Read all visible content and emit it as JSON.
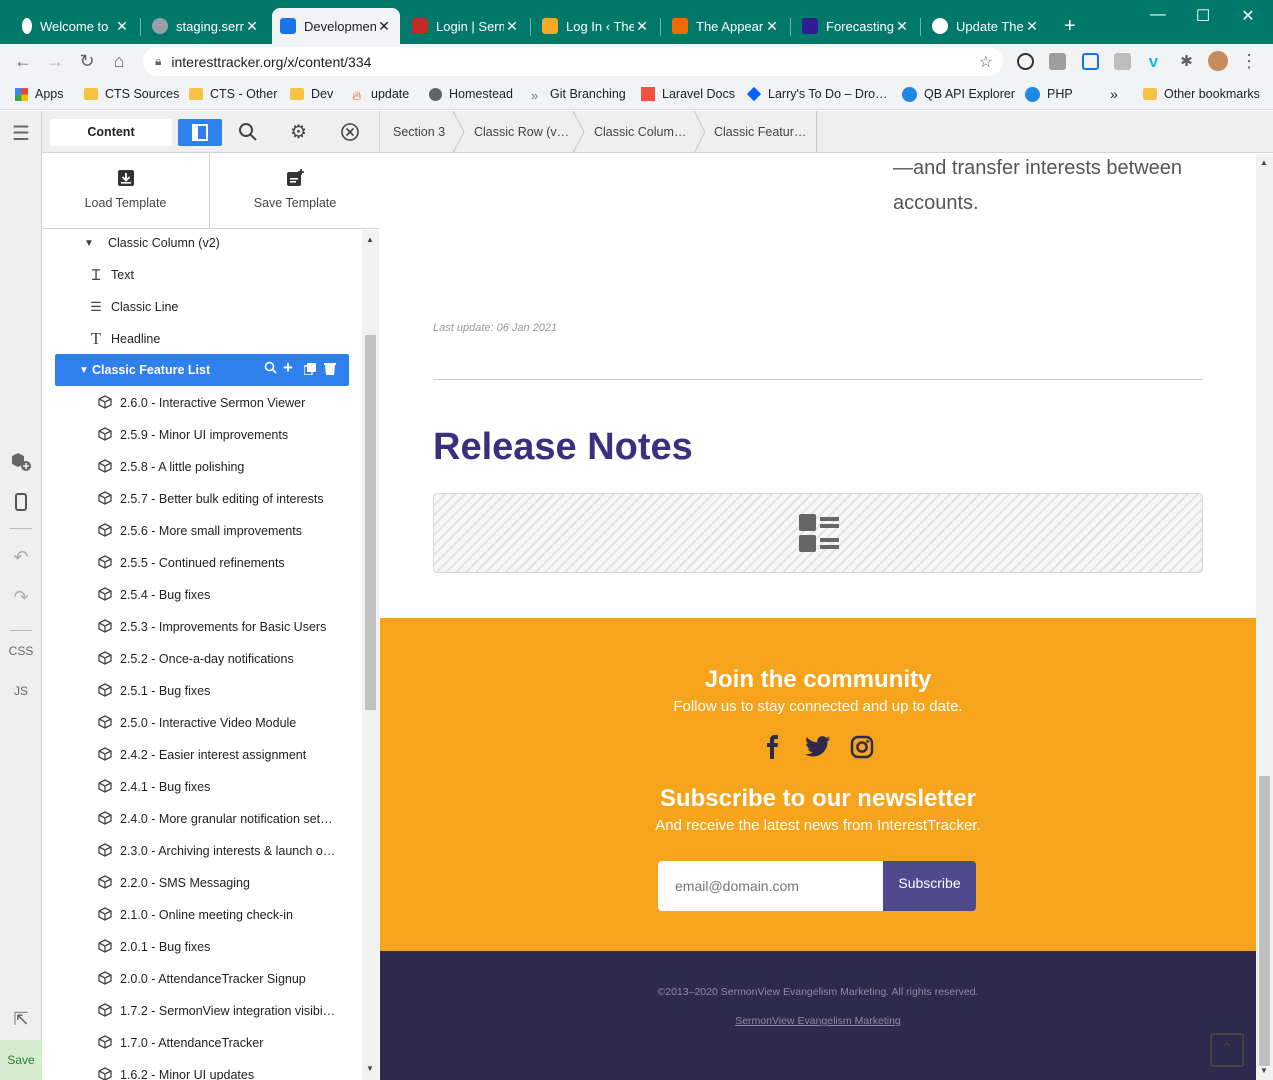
{
  "browser": {
    "tabs": [
      {
        "title": "Welcome to",
        "color": "#ffffff"
      },
      {
        "title": "staging.serm",
        "color": "#9aa0a6"
      },
      {
        "title": "Developmen",
        "color": "#1a73e8"
      },
      {
        "title": "Login | Serm",
        "color": "#c62828"
      },
      {
        "title": "Log In ‹ The",
        "color": "#f9a825"
      },
      {
        "title": "The Appeari",
        "color": "#ef6c00"
      },
      {
        "title": "Forecasting",
        "color": "#311b92"
      },
      {
        "title": "Update Ther",
        "color": "#ffffff"
      }
    ],
    "new_tab": "+",
    "url": "interesttracker.org/x/content/334",
    "bookmarks": [
      "Apps",
      "CTS Sources",
      "CTS - Other",
      "Dev",
      "update",
      "Homestead",
      "Git Branching",
      "Laravel Docs",
      "Larry's To Do – Dro…",
      "QB API Explorer",
      "PHP"
    ],
    "bookmarks_overflow": "»",
    "other_bookmarks": "Other bookmarks"
  },
  "rail": {
    "css": "CSS",
    "js": "JS",
    "save": "Save"
  },
  "panel": {
    "content_tab": "Content",
    "load_template": "Load Template",
    "save_template": "Save Template"
  },
  "tree": {
    "parent": "Classic Column (v2)",
    "children": [
      {
        "label": "Text",
        "icon": "text-cursor-icon"
      },
      {
        "label": "Classic Line",
        "icon": "line-icon"
      },
      {
        "label": "Headline",
        "icon": "headline-icon"
      }
    ],
    "selected": "Classic Feature List",
    "features": [
      "2.6.0 - Interactive Sermon Viewer",
      "2.5.9 - Minor UI improvements",
      "2.5.8 - A little polishing",
      "2.5.7 - Better bulk editing of interests",
      "2.5.6 - More small improvements",
      "2.5.5 - Continued refinements",
      "2.5.4 - Bug fixes",
      "2.5.3 - Improvements for Basic Users",
      "2.5.2 - Once-a-day notifications",
      "2.5.1 - Bug fixes",
      "2.5.0 - Interactive Video Module",
      "2.4.2 - Easier interest assignment",
      "2.4.1 - Bug fixes",
      "2.4.0 - More granular notification set…",
      "2.3.0 - Archiving interests & launch o…",
      "2.2.0 - SMS Messaging",
      "2.1.0 - Online meeting check-in",
      "2.0.1 - Bug fixes",
      "2.0.0 - AttendanceTracker Signup",
      "1.7.2 - SermonView integration visibi…",
      "1.7.0 - AttendanceTracker",
      "1.6.2 - Minor UI updates"
    ]
  },
  "breadcrumb": [
    "Section 3",
    "Classic Row (v…",
    "Classic Colum…",
    "Classic Featur…"
  ],
  "page": {
    "intro_line1": "—and transfer interests between",
    "intro_line2": "accounts.",
    "last_update": "Last update: 06 Jan 2021",
    "release_notes": "Release Notes",
    "community_title": "Join the community",
    "community_sub": "Follow us to stay connected and up to date.",
    "newsletter_title": "Subscribe to our newsletter",
    "newsletter_sub": "And receive the latest news from InterestTracker.",
    "email_placeholder": "email@domain.com",
    "subscribe": "Subscribe",
    "copyright": "©2013–2020 SermonView Evangelism Marketing. All rights reserved.",
    "footer_link": "SermonView Evangelism Marketing"
  },
  "colors": {
    "chrome_green": "#00796b",
    "accent_blue": "#1a73e8",
    "heading_purple": "#3d2f7e",
    "orange": "#f6a41c",
    "navy": "#2e2a4e",
    "subscribe_btn": "#4f4a8f"
  }
}
